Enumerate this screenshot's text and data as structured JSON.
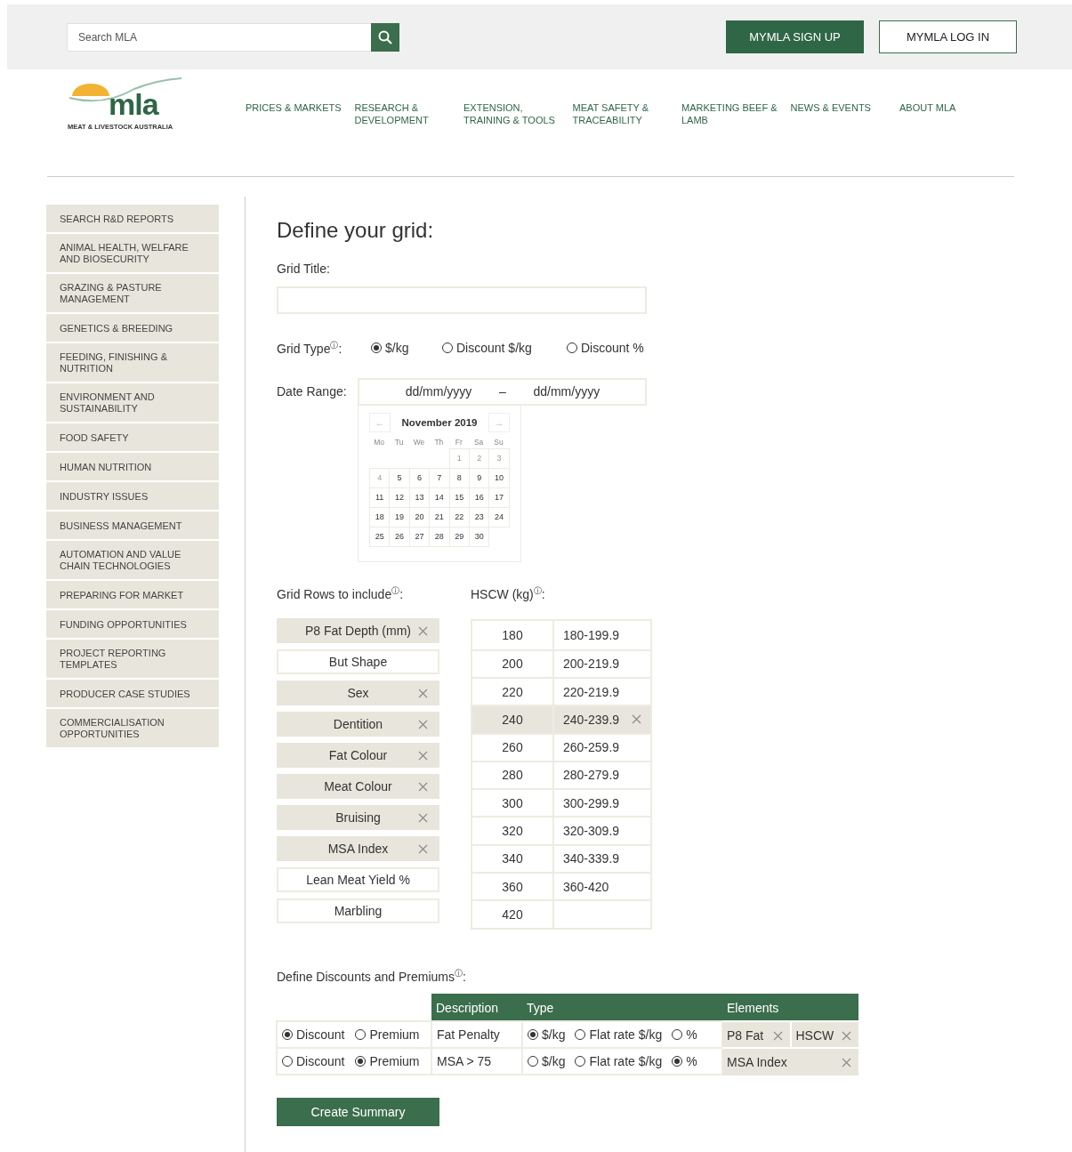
{
  "header": {
    "search": {
      "placeholder": "Search MLA"
    },
    "buttons": [
      {
        "label": "MYMLA SIGN UP",
        "kind": "primary"
      },
      {
        "label": "MYMLA LOG IN",
        "kind": "outline"
      }
    ]
  },
  "logo": {
    "mark": "mla",
    "tagline": "MEAT & LIVESTOCK AUSTRALIA"
  },
  "nav": [
    "PRICES & MARKETS",
    "RESEARCH & DEVELOPMENT",
    "EXTENSION, TRAINING & TOOLS",
    "MEAT SAFETY & TRACEABILITY",
    "MARKETING BEEF & LAMB",
    "NEWS & EVENTS",
    "ABOUT MLA"
  ],
  "sidebar": {
    "items": [
      "SEARCH R&D REPORTS",
      "ANIMAL HEALTH, WELFARE AND BIOSECURITY",
      "GRAZING & PASTURE MANAGEMENT",
      "GENETICS & BREEDING",
      "FEEDING, FINISHING & NUTRITION",
      "ENVIRONMENT AND SUSTAINABILITY",
      "FOOD SAFETY",
      "HUMAN NUTRITION",
      "INDUSTRY ISSUES",
      "BUSINESS MANAGEMENT",
      "AUTOMATION AND VALUE CHAIN TECHNOLOGIES",
      "PREPARING FOR MARKET",
      "FUNDING OPPORTUNITIES",
      "PROJECT REPORTING TEMPLATES",
      "PRODUCER CASE STUDIES",
      "COMMERCIALISATION OPPORTUNITIES"
    ]
  },
  "form": {
    "heading": "Define your grid:",
    "grid_title": {
      "label": "Grid Title:"
    },
    "grid_type": {
      "label": "Grid Type$^{ⓘ}$:",
      "options": [
        {
          "label": "$/kg",
          "selected": true
        },
        {
          "label": "Discount $/kg",
          "selected": false
        },
        {
          "label": "Discount %",
          "selected": false
        }
      ]
    },
    "date_range": {
      "label": "Date Range:",
      "from": {
        "placeholder": "dd/mm/yyyy"
      },
      "separator": "–",
      "to": {
        "placeholder": "dd/mm/yyyy"
      },
      "calendar": {
        "prev": "←",
        "month": "November 2019",
        "next": "→",
        "weekdays": [
          "Mo",
          "Tu",
          "We",
          "Th",
          "Fr",
          "Sa",
          "Su"
        ],
        "weeks": [
          [
            {
              "day": "1",
              "disabled": true
            },
            {
              "day": "2",
              "disabled": true
            },
            {
              "day": "3",
              "disabled": true
            }
          ],
          [
            {
              "day": "4",
              "disabled": true
            },
            {
              "day": "5",
              "disabled": false
            },
            {
              "day": "6",
              "disabled": false
            },
            {
              "day": "7",
              "disabled": false
            },
            {
              "day": "8",
              "disabled": false
            },
            {
              "day": "9",
              "disabled": false
            },
            {
              "day": "10",
              "disabled": false
            }
          ],
          [
            {
              "day": "11",
              "disabled": false
            },
            {
              "day": "12",
              "disabled": false
            },
            {
              "day": "13",
              "disabled": false
            },
            {
              "day": "14",
              "disabled": false
            },
            {
              "day": "15",
              "disabled": false
            },
            {
              "day": "16",
              "disabled": false
            },
            {
              "day": "17",
              "disabled": false
            }
          ],
          [
            {
              "day": "18",
              "disabled": false
            },
            {
              "day": "19",
              "disabled": false
            },
            {
              "day": "20",
              "disabled": false
            },
            {
              "day": "21",
              "disabled": false
            },
            {
              "day": "22",
              "disabled": false
            },
            {
              "day": "23",
              "disabled": false
            },
            {
              "day": "24",
              "disabled": false
            }
          ],
          [
            {
              "day": "25",
              "disabled": false
            },
            {
              "day": "26",
              "disabled": false
            },
            {
              "day": "27",
              "disabled": false
            },
            {
              "day": "28",
              "disabled": false
            },
            {
              "day": "29",
              "disabled": false
            },
            {
              "day": "30",
              "disabled": false
            }
          ]
        ]
      }
    },
    "grid_rows": {
      "label": "Grid Rows to include$^{ⓘ}$:",
      "items": [
        {
          "label": "P8 Fat Depth (mm)",
          "selected": true
        },
        {
          "label": "But Shape",
          "selected": false
        },
        {
          "label": "Sex",
          "selected": true
        },
        {
          "label": "Dentition",
          "selected": true
        },
        {
          "label": "Fat Colour",
          "selected": true
        },
        {
          "label": "Meat Colour",
          "selected": true
        },
        {
          "label": "Bruising",
          "selected": true
        },
        {
          "label": "MSA Index",
          "selected": true
        },
        {
          "label": "Lean Meat Yield %",
          "selected": false
        },
        {
          "label": "Marbling",
          "selected": false
        }
      ]
    },
    "hscw": {
      "label": "HSCW (kg)$^{ⓘ}$:",
      "rows": [
        {
          "weight": "180",
          "range": "180-199.9",
          "selected": false
        },
        {
          "weight": "200",
          "range": "200-219.9",
          "selected": false
        },
        {
          "weight": "220",
          "range": "220-219.9",
          "selected": false
        },
        {
          "weight": "240",
          "range": "240-239.9",
          "selected": true
        },
        {
          "weight": "260",
          "range": "260-259.9",
          "selected": false
        },
        {
          "weight": "280",
          "range": "280-279.9",
          "selected": false
        },
        {
          "weight": "300",
          "range": "300-299.9",
          "selected": false
        },
        {
          "weight": "320",
          "range": "320-309.9",
          "selected": false
        },
        {
          "weight": "340",
          "range": "340-339.9",
          "selected": false
        },
        {
          "weight": "360",
          "range": "360-420",
          "selected": false
        },
        {
          "weight": "420",
          "selected": false
        }
      ]
    },
    "discounts": {
      "label": "Define Discounts and Premiums$^{ⓘ}$:",
      "columns": [
        "Description",
        "Type",
        "Elements"
      ],
      "rows": [
        {
          "modes": [
            {
              "label": "Discount",
              "selected": true
            },
            {
              "label": "Premium",
              "selected": false
            }
          ],
          "description": "Fat Penalty",
          "types": [
            {
              "label": "$/kg",
              "selected": true
            },
            {
              "label": "Flat rate $/kg",
              "selected": false
            },
            {
              "label": "%",
              "selected": false
            }
          ],
          "elements": [
            "P8 Fat",
            "HSCW"
          ]
        },
        {
          "modes": [
            {
              "label": "Discount",
              "selected": false
            },
            {
              "label": "Premium",
              "selected": true
            }
          ],
          "description": "MSA > 75",
          "types": [
            {
              "label": "$/kg",
              "selected": false
            },
            {
              "label": "Flat rate $/kg",
              "selected": false
            },
            {
              "label": "%",
              "selected": true
            }
          ],
          "elements": [
            "MSA Index"
          ]
        }
      ]
    },
    "submit": "Create Summary"
  }
}
